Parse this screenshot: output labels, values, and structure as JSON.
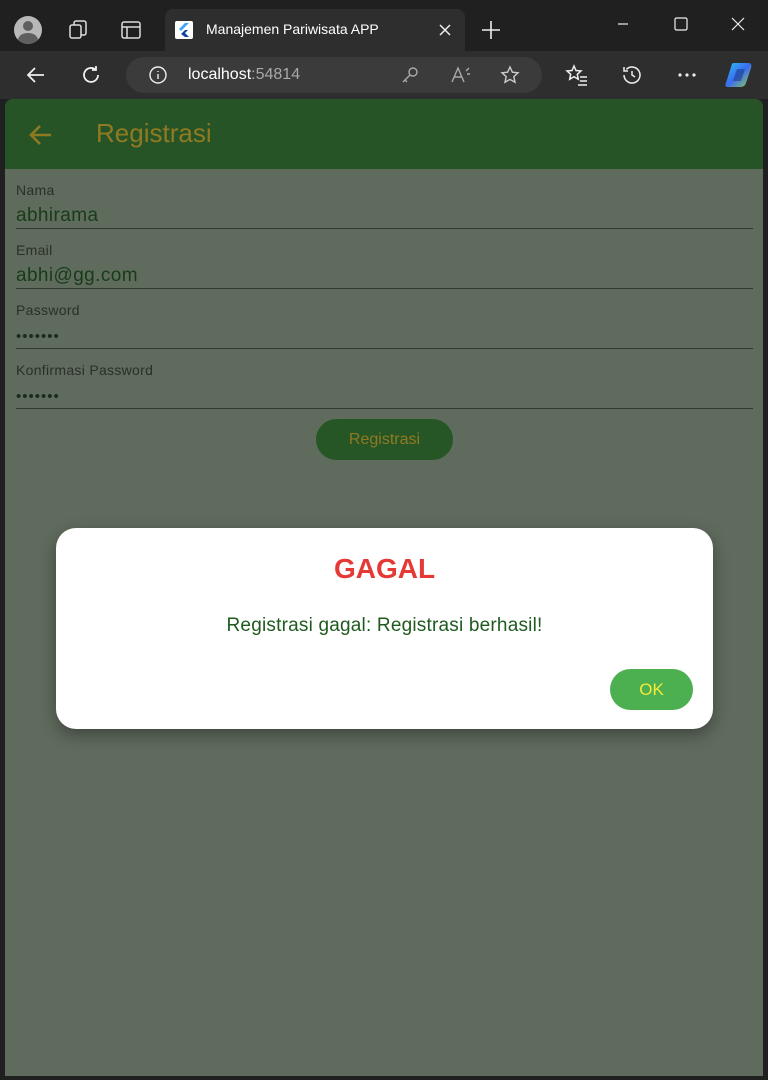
{
  "browser": {
    "tab_title": "Manajemen Pariwisata APP",
    "url_host": "localhost",
    "url_port": ":54814"
  },
  "appbar": {
    "title": "Registrasi"
  },
  "form": {
    "fields": [
      {
        "label": "Nama",
        "value": "abhirama"
      },
      {
        "label": "Email",
        "value": "abhi@gg.com"
      },
      {
        "label": "Password",
        "value": "•••••••"
      },
      {
        "label": "Konfirmasi Password",
        "value": "•••••••"
      }
    ],
    "submit_label": "Registrasi"
  },
  "dialog": {
    "title": "GAGAL",
    "message": "Registrasi gagal: Registrasi berhasil!",
    "ok_label": "OK"
  },
  "colors": {
    "appbar": "#265427",
    "background": "#5f6b5d",
    "title_text": "#8f7a22",
    "error_title": "#e53935",
    "ok_button": "#4caf50"
  }
}
